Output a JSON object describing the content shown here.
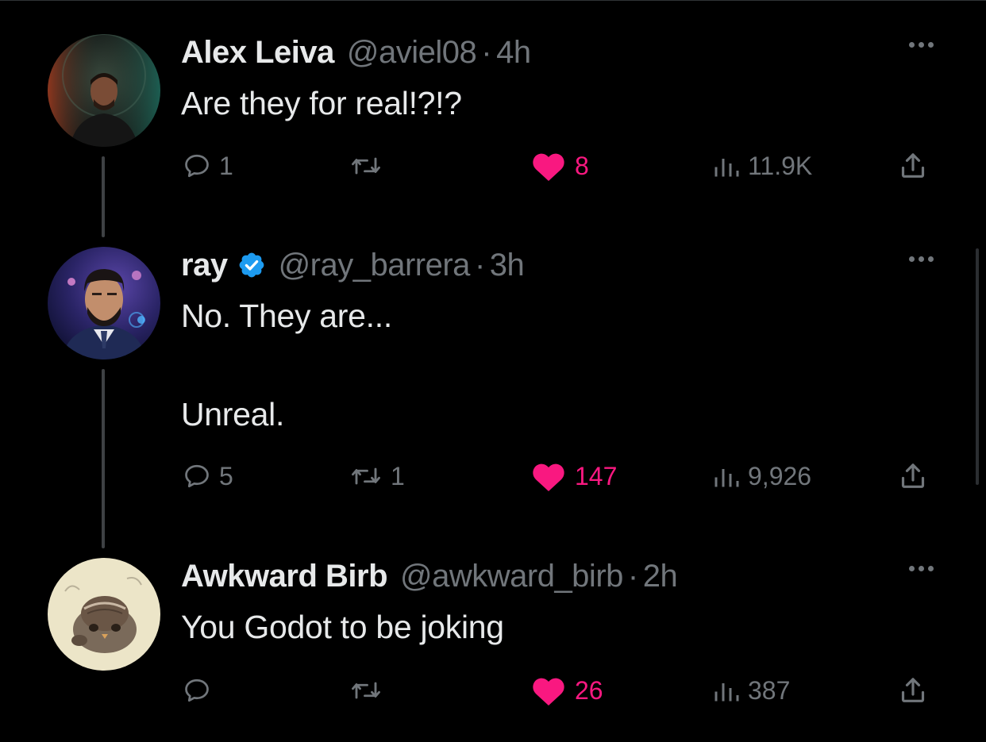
{
  "tweets": [
    {
      "name": "Alex Leiva",
      "verified": false,
      "handle": "@aviel08",
      "separator": "·",
      "time": "4h",
      "text": "Are they for real!?!?",
      "replies": "1",
      "retweets": "",
      "likes": "8",
      "views": "11.9K"
    },
    {
      "name": "ray",
      "verified": true,
      "handle": "@ray_barrera",
      "separator": "·",
      "time": "3h",
      "text": "No. They are...\n\nUnreal.",
      "replies": "5",
      "retweets": "1",
      "likes": "147",
      "views": "9,926"
    },
    {
      "name": "Awkward Birb",
      "verified": false,
      "handle": "@awkward_birb",
      "separator": "·",
      "time": "2h",
      "text": "You Godot to be joking",
      "replies": "",
      "retweets": "",
      "likes": "26",
      "views": "387"
    }
  ],
  "colors": {
    "background": "#000000",
    "primary_text": "#e7e9ea",
    "secondary_text": "#71767b",
    "like_pink": "#f91880",
    "verified_blue": "#1d9bf0"
  },
  "icons": {
    "reply": "reply-icon",
    "retweet": "retweet-icon",
    "like": "heart-filled-icon",
    "views": "views-icon",
    "share": "share-icon",
    "more": "more-icon",
    "verified": "verified-badge-icon"
  }
}
